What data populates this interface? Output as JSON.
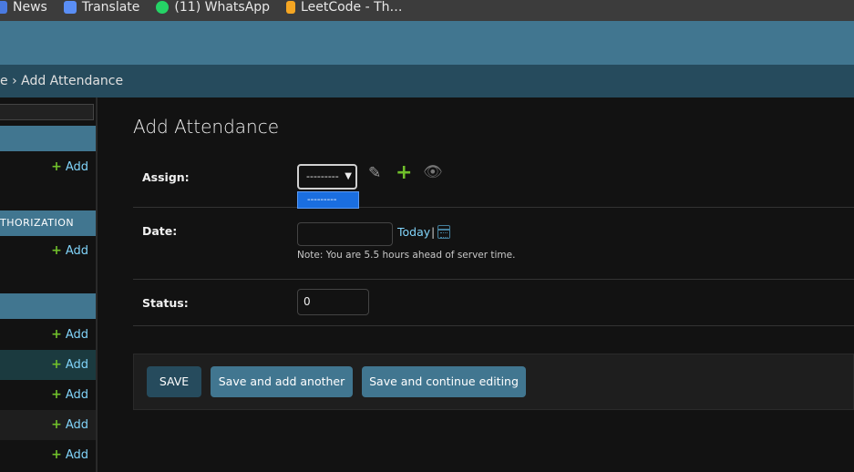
{
  "bookmarks": [
    {
      "label": "News",
      "icon": "news-icon"
    },
    {
      "label": "Translate",
      "icon": "translate-icon"
    },
    {
      "label": "(11) WhatsApp",
      "icon": "whatsapp-icon"
    },
    {
      "label": "LeetCode - Th…",
      "icon": "leetcode-icon"
    }
  ],
  "breadcrumbs": {
    "text": "e › Add Attendance"
  },
  "sidebar": {
    "captions": [
      "",
      "THORIZATION",
      ""
    ],
    "add_label": "Add"
  },
  "page": {
    "title": "Add Attendance"
  },
  "form": {
    "assign": {
      "label": "Assign:",
      "selected": "---------",
      "dropdown_option": "---------",
      "icons": [
        "pencil-icon",
        "plus-icon",
        "eye-icon"
      ]
    },
    "date": {
      "label": "Date:",
      "value": "",
      "today_label": "Today",
      "separator": "|",
      "help": "Note: You are 5.5 hours ahead of server time."
    },
    "status": {
      "label": "Status:",
      "value": "0"
    }
  },
  "submit": {
    "save": "SAVE",
    "save_add_another": "Save and add another",
    "save_continue": "Save and continue editing"
  },
  "colors": {
    "header": "#417690",
    "breadcrumbs": "#264b5d",
    "link": "#81d4fa",
    "add_green": "#70bf2b",
    "background": "#121212"
  }
}
